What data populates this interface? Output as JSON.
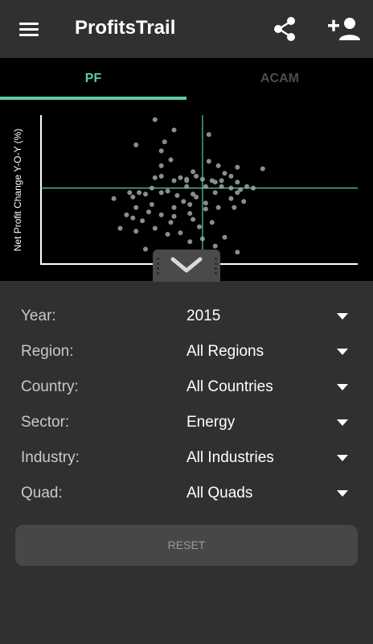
{
  "app": {
    "title": "ProfitsTrail"
  },
  "tabs": [
    {
      "label": "PF",
      "active": true
    },
    {
      "label": "ACAM",
      "active": false
    }
  ],
  "chart": {
    "ylabel": "Net Profit Change Y-O-Y (%)",
    "accent_color": "#5fcaa4"
  },
  "chart_data": {
    "type": "scatter",
    "title": "",
    "xlabel": "",
    "ylabel": "Net Profit Change Y-O-Y (%)",
    "xlim": [
      0,
      100
    ],
    "ylim": [
      0,
      100
    ],
    "crosshair": {
      "x": 51,
      "y": 51
    },
    "points": [
      [
        36,
        97
      ],
      [
        42,
        90
      ],
      [
        39,
        82
      ],
      [
        53,
        87
      ],
      [
        30,
        80
      ],
      [
        38,
        76
      ],
      [
        41,
        70
      ],
      [
        38,
        66
      ],
      [
        53,
        69
      ],
      [
        70,
        64
      ],
      [
        62,
        65
      ],
      [
        56,
        66
      ],
      [
        48,
        62
      ],
      [
        58,
        61
      ],
      [
        49,
        59
      ],
      [
        51,
        57
      ],
      [
        60,
        59
      ],
      [
        46,
        57
      ],
      [
        54,
        56
      ],
      [
        57,
        56
      ],
      [
        62,
        55
      ],
      [
        55,
        55
      ],
      [
        42,
        56
      ],
      [
        44,
        58
      ],
      [
        36,
        58
      ],
      [
        38,
        59
      ],
      [
        46,
        52
      ],
      [
        52,
        52
      ],
      [
        57,
        52
      ],
      [
        60,
        51
      ],
      [
        63,
        50
      ],
      [
        65,
        52
      ],
      [
        67,
        51
      ],
      [
        62,
        48
      ],
      [
        55,
        48
      ],
      [
        48,
        47
      ],
      [
        40,
        49
      ],
      [
        35,
        51
      ],
      [
        33,
        47
      ],
      [
        31,
        48
      ],
      [
        29,
        45
      ],
      [
        28,
        48
      ],
      [
        38,
        48
      ],
      [
        43,
        46
      ],
      [
        49,
        45
      ],
      [
        45,
        42
      ],
      [
        52,
        41
      ],
      [
        60,
        44
      ],
      [
        47,
        40
      ],
      [
        42,
        38
      ],
      [
        35,
        40
      ],
      [
        30,
        38
      ],
      [
        34,
        35
      ],
      [
        38,
        33
      ],
      [
        42,
        32
      ],
      [
        47,
        34
      ],
      [
        52,
        37
      ],
      [
        56,
        38
      ],
      [
        48,
        30
      ],
      [
        41,
        28
      ],
      [
        32,
        29
      ],
      [
        29,
        31
      ],
      [
        25,
        24
      ],
      [
        30,
        22
      ],
      [
        40,
        20
      ],
      [
        47,
        15
      ],
      [
        55,
        12
      ],
      [
        62,
        8
      ],
      [
        33,
        10
      ],
      [
        23,
        44
      ],
      [
        27,
        33
      ],
      [
        58,
        18
      ],
      [
        50,
        25
      ],
      [
        36,
        24
      ],
      [
        44,
        21
      ],
      [
        51,
        17
      ],
      [
        54,
        28
      ],
      [
        61,
        38
      ],
      [
        64,
        42
      ],
      [
        46,
        56
      ]
    ]
  },
  "filters": [
    {
      "label": "Year:",
      "value": "2015"
    },
    {
      "label": "Region:",
      "value": "All Regions"
    },
    {
      "label": "Country:",
      "value": "All Countries"
    },
    {
      "label": "Sector:",
      "value": "Energy"
    },
    {
      "label": "Industry:",
      "value": "All Industries"
    },
    {
      "label": "Quad:",
      "value": "All Quads"
    }
  ],
  "reset": {
    "label": "RESET"
  },
  "icons": {
    "menu": "hamburger-menu-icon",
    "share": "share-icon",
    "add_user": "add-person-icon",
    "collapse": "chevron-down-icon",
    "dropdown": "caret-down-icon"
  },
  "colors": {
    "background": "#303030",
    "chart_background": "#000000",
    "accent": "#5fcaa4",
    "point": "#8c8c8c",
    "inactive_tab": "#4d4d4d"
  }
}
